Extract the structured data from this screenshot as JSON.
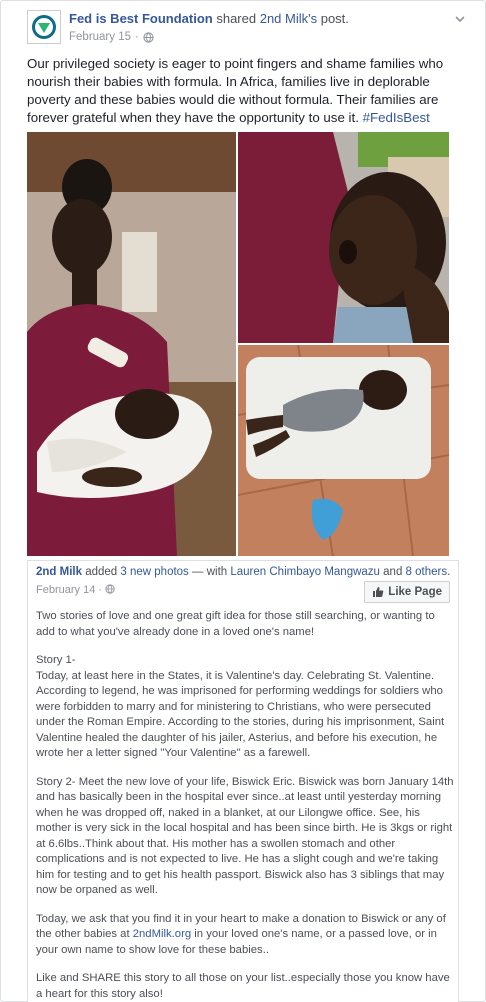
{
  "post": {
    "page_name": "Fed is Best Foundation",
    "action_text": " shared ",
    "shared_source": "2nd Milk's",
    "post_word": " post.",
    "date": "February 15",
    "audience_icon": "globe-icon",
    "text": "Our privileged society is eager to point fingers and shame families who nourish their babies with formula. In Africa, families live in deplorable poverty and these babies would die without formula. Their families are forever grateful when they have the opportunity to use it. ",
    "hashtag": "#FedIsBest"
  },
  "shared": {
    "author": "2nd Milk",
    "added": " added ",
    "new_photos": "3 new photos",
    "with": " — with ",
    "tagged": "Lauren Chimbayo Mangwazu",
    "and": " and ",
    "others": "8 others",
    "end": ".",
    "date": "February 14",
    "like_button": "Like Page",
    "p1": "Two stories of love and one great gift idea for those still searching, or wanting to add to what you've already done in a loved one's name!",
    "p2_title": "Story 1-",
    "p2": "Today, at least here in the States, it is Valentine's day. Celebrating St. Valentine. According to legend, he was imprisoned for performing weddings for soldiers who were forbidden to marry and for ministering to Christians, who were persecuted under the Roman Empire. According to the stories, during his imprisonment, Saint Valentine healed the daughter of his jailer, Asterius, and before his execution, he wrote her a letter signed \"Your Valentine\" as a farewell.",
    "p3": "Story 2- Meet the new love of your life, Biswick Eric. Biswick was born January 14th and has basically been in the hospital ever since..at least until yesterday morning when he was dropped off, naked in a blanket, at our Lilongwe office. See, his mother is very sick in the local hospital and has been since birth. He is 3kgs or right at 6.6lbs..Think about that. His mother has a swollen stomach and other complications and is not expected to live. He has a slight cough and we're taking him for testing and to get his health passport. Biswick also has 3 siblings that may now be orpaned as well.",
    "p4_a": "Today, we ask that you find it in your heart to make a donation to Biswick or any of the other babies at ",
    "p4_link": "2ndMilk.org",
    "p4_b": " in your loved one's name, or a passed love, or in your own name to show love for these babies..",
    "p5": "Like and SHARE this story to all those on your list..especially those you know have a heart for this story also!"
  },
  "colors": {
    "link": "#365899",
    "text": "#1d2129",
    "muted": "#90949c"
  }
}
